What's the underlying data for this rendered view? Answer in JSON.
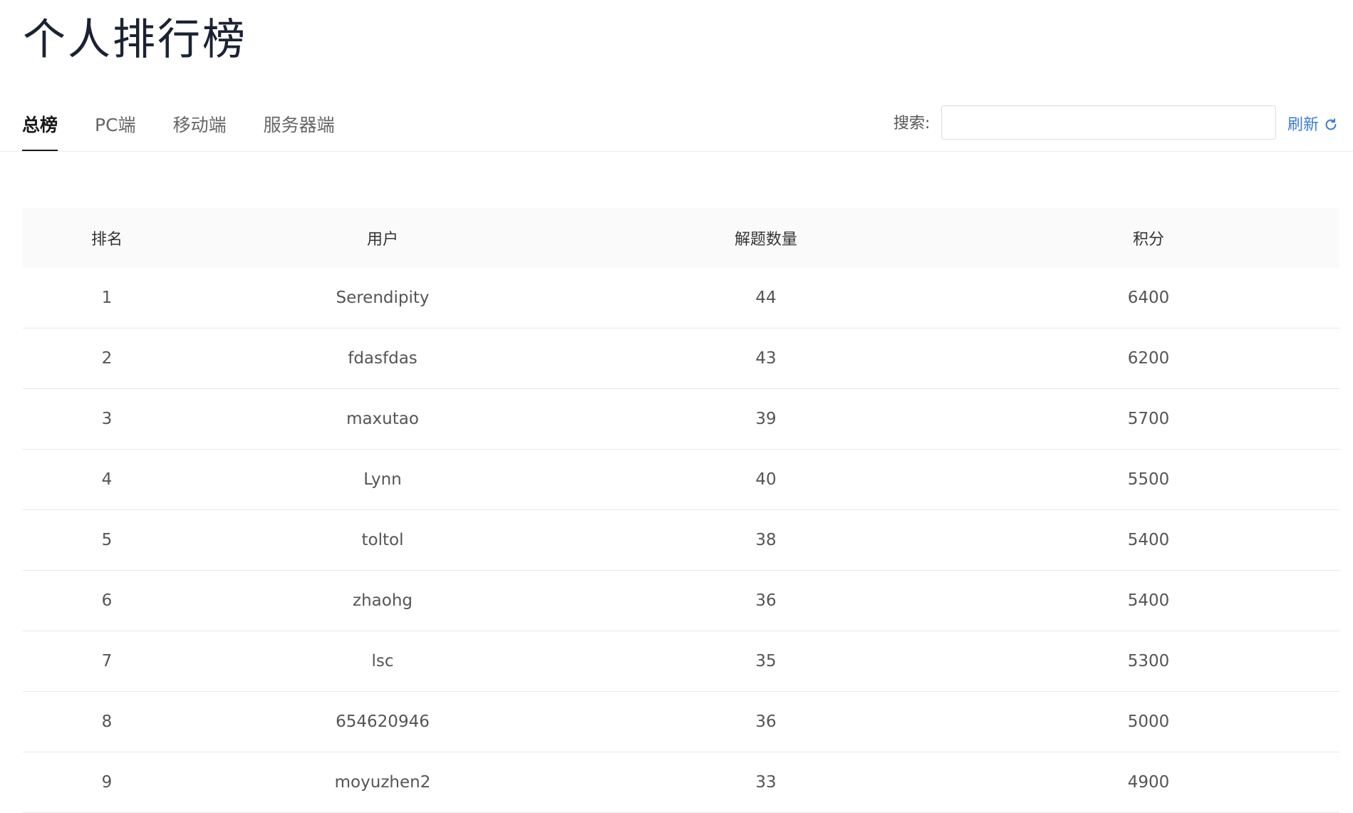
{
  "page": {
    "title": "个人排行榜"
  },
  "tabs": [
    {
      "label": "总榜",
      "active": true
    },
    {
      "label": "PC端",
      "active": false
    },
    {
      "label": "移动端",
      "active": false
    },
    {
      "label": "服务器端",
      "active": false
    }
  ],
  "search": {
    "label": "搜索:",
    "value": "",
    "placeholder": ""
  },
  "refresh": {
    "label": "刷新",
    "icon": "refresh-icon",
    "color": "#3a7bd5"
  },
  "table": {
    "columns": [
      "排名",
      "用户",
      "解题数量",
      "积分"
    ],
    "rows": [
      {
        "rank": "1",
        "user": "Serendipity",
        "solved": "44",
        "score": "6400"
      },
      {
        "rank": "2",
        "user": "fdasfdas",
        "solved": "43",
        "score": "6200"
      },
      {
        "rank": "3",
        "user": "maxutao",
        "solved": "39",
        "score": "5700"
      },
      {
        "rank": "4",
        "user": "Lynn",
        "solved": "40",
        "score": "5500"
      },
      {
        "rank": "5",
        "user": "toltol",
        "solved": "38",
        "score": "5400"
      },
      {
        "rank": "6",
        "user": "zhaohg",
        "solved": "36",
        "score": "5400"
      },
      {
        "rank": "7",
        "user": "lsc",
        "solved": "35",
        "score": "5300"
      },
      {
        "rank": "8",
        "user": "654620946",
        "solved": "36",
        "score": "5000"
      },
      {
        "rank": "9",
        "user": "moyuzhen2",
        "solved": "33",
        "score": "4900"
      }
    ]
  }
}
